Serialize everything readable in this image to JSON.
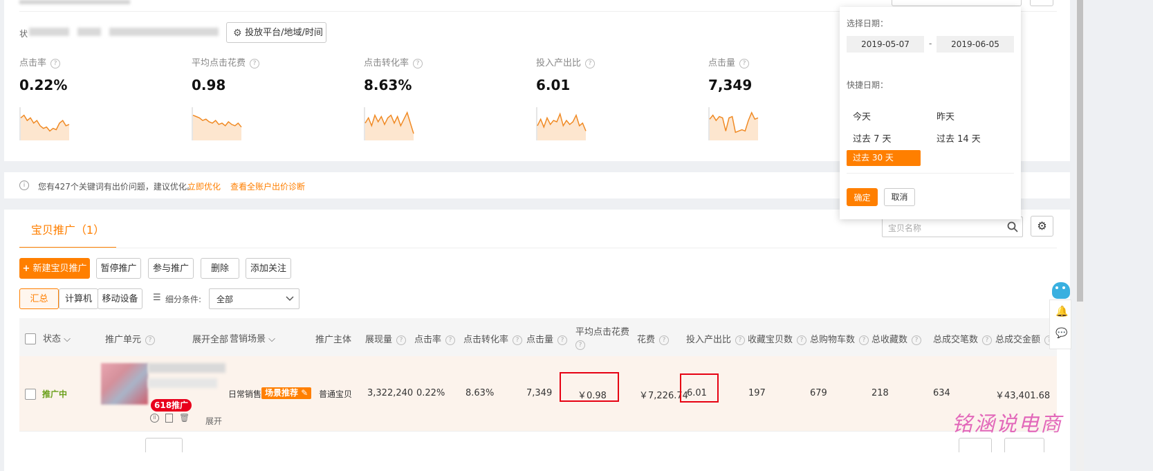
{
  "stats_card": {
    "platform_button": "投放平台/地域/时间",
    "metrics": [
      {
        "label": "点击率",
        "value": "0.22%"
      },
      {
        "label": "平均点击花费",
        "value": "0.98"
      },
      {
        "label": "点击转化率",
        "value": "8.63%"
      },
      {
        "label": "投入产出比",
        "value": "6.01"
      },
      {
        "label": "点击量",
        "value": "7,349"
      }
    ],
    "colors": {
      "spark_line": "#f08a24",
      "spark_fill": "#fde6cf"
    }
  },
  "notice": {
    "text": "您有427个关键词有出价问题，建议优化。",
    "link1": "立即优化",
    "link2": "查看全账户出价诊断"
  },
  "promo": {
    "tab": "宝贝推广（1）",
    "search_placeholder": "宝贝名称",
    "actions": {
      "new": "新建宝贝推广",
      "pause": "暂停推广",
      "join": "参与推广",
      "delete": "删除",
      "follow": "添加关注"
    },
    "device_tabs": [
      "汇总",
      "计算机",
      "移动设备"
    ],
    "filter_label": "细分条件:",
    "filter_value": "全部"
  },
  "table": {
    "headers": {
      "status": "状态",
      "unit": "推广单元",
      "expand_all": "展开全部",
      "scene": "营销场景",
      "subject": "推广主体",
      "impressions": "展现量",
      "ctr": "点击率",
      "cvr": "点击转化率",
      "clicks": "点击量",
      "cpc": "平均点击花费",
      "cost": "花费",
      "roi": "投入产出比",
      "fav_items": "收藏宝贝数",
      "cart": "总购物车数",
      "fav_total": "总收藏数",
      "orders": "总成交笔数",
      "gmv": "总成交金额"
    },
    "row": {
      "status": "推广中",
      "badge": "618推广",
      "expand": "展开",
      "scene": "日常销售",
      "scene_tag": "场景推荐",
      "subject": "普通宝贝",
      "impressions": "3,322,240",
      "ctr": "0.22%",
      "cvr": "8.63%",
      "clicks": "7,349",
      "cpc": "￥0.98",
      "cost": "￥7,226.74",
      "roi": "6.01",
      "fav_items": "197",
      "cart": "679",
      "fav_total": "218",
      "orders": "634",
      "gmv": "￥43,401.68"
    }
  },
  "date_popup": {
    "select_label": "选择日期：",
    "start": "2019-05-07",
    "dash": "-",
    "end": "2019-06-05",
    "quick_label": "快捷日期：",
    "quick": [
      "今天",
      "昨天",
      "过去 7 天",
      "过去 14 天",
      "过去 30 天"
    ],
    "confirm": "确定",
    "cancel": "取消"
  },
  "watermark": "铭涵说电商",
  "accent": "#ff7f00"
}
